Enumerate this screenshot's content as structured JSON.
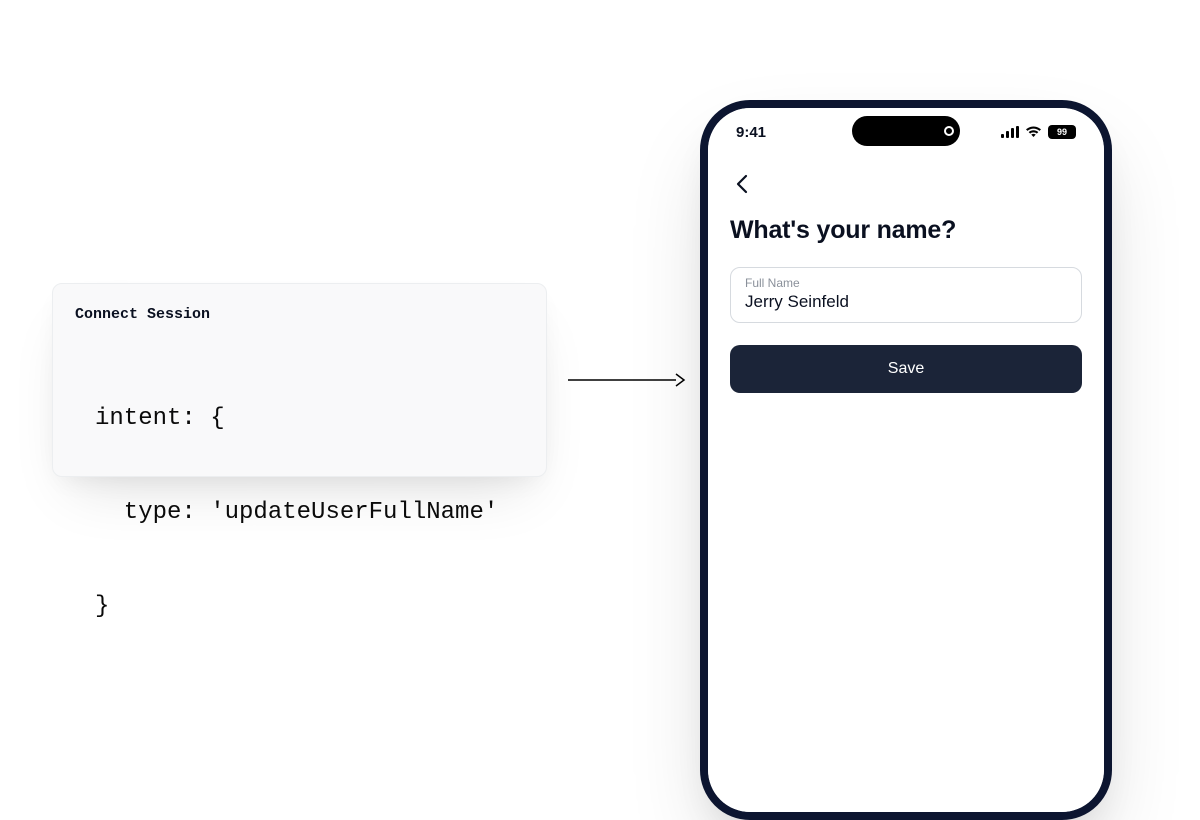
{
  "code_card": {
    "title": "Connect Session",
    "lines": [
      "intent: {",
      "  type: 'updateUserFullName'",
      "}"
    ]
  },
  "phone": {
    "status": {
      "time": "9:41",
      "battery_label": "99"
    },
    "screen": {
      "title": "What's your name?",
      "field_label": "Full Name",
      "field_value": "Jerry Seinfeld",
      "save_label": "Save"
    }
  },
  "icons": {
    "back": "chevron-left-icon",
    "signal": "signal-icon",
    "wifi": "wifi-icon",
    "battery": "battery-icon",
    "island_camera": "camera-dot-icon"
  },
  "colors": {
    "phone_border": "#0c1530",
    "button_bg": "#1b2438",
    "field_border": "#d6dadf",
    "card_bg": "#f9f9fa"
  }
}
